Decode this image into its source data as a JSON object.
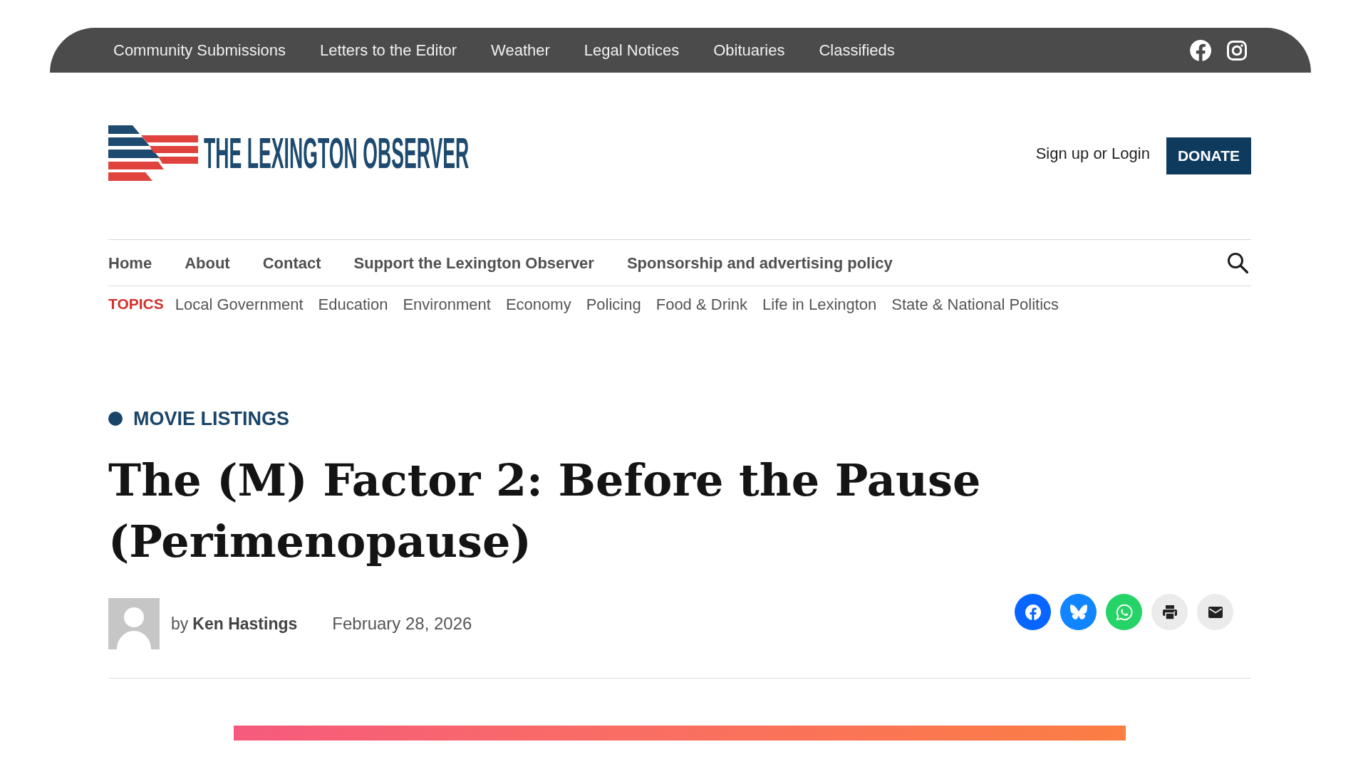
{
  "utility_nav": {
    "links": [
      "Community Submissions",
      "Letters to the Editor",
      "Weather",
      "Legal Notices",
      "Obituaries",
      "Classifieds"
    ]
  },
  "masthead": {
    "logo_text": "THE LEXINGTON OBSERVER",
    "login_link": "Sign up or Login",
    "donate_button": "DONATE"
  },
  "main_nav": {
    "items": [
      "Home",
      "About",
      "Contact",
      "Support the Lexington Observer",
      "Sponsorship and advertising policy"
    ]
  },
  "topics": {
    "label": "TOPICS",
    "items": [
      "Local Government",
      "Education",
      "Environment",
      "Economy",
      "Policing",
      "Food & Drink",
      "Life in Lexington",
      "State & National Politics"
    ]
  },
  "article": {
    "category": "MOVIE LISTINGS",
    "title": "The (M) Factor 2: Before the Pause (Perimenopause)",
    "byline": {
      "prefix": "by",
      "author": "Ken Hastings"
    },
    "date": "February 28, 2026"
  }
}
